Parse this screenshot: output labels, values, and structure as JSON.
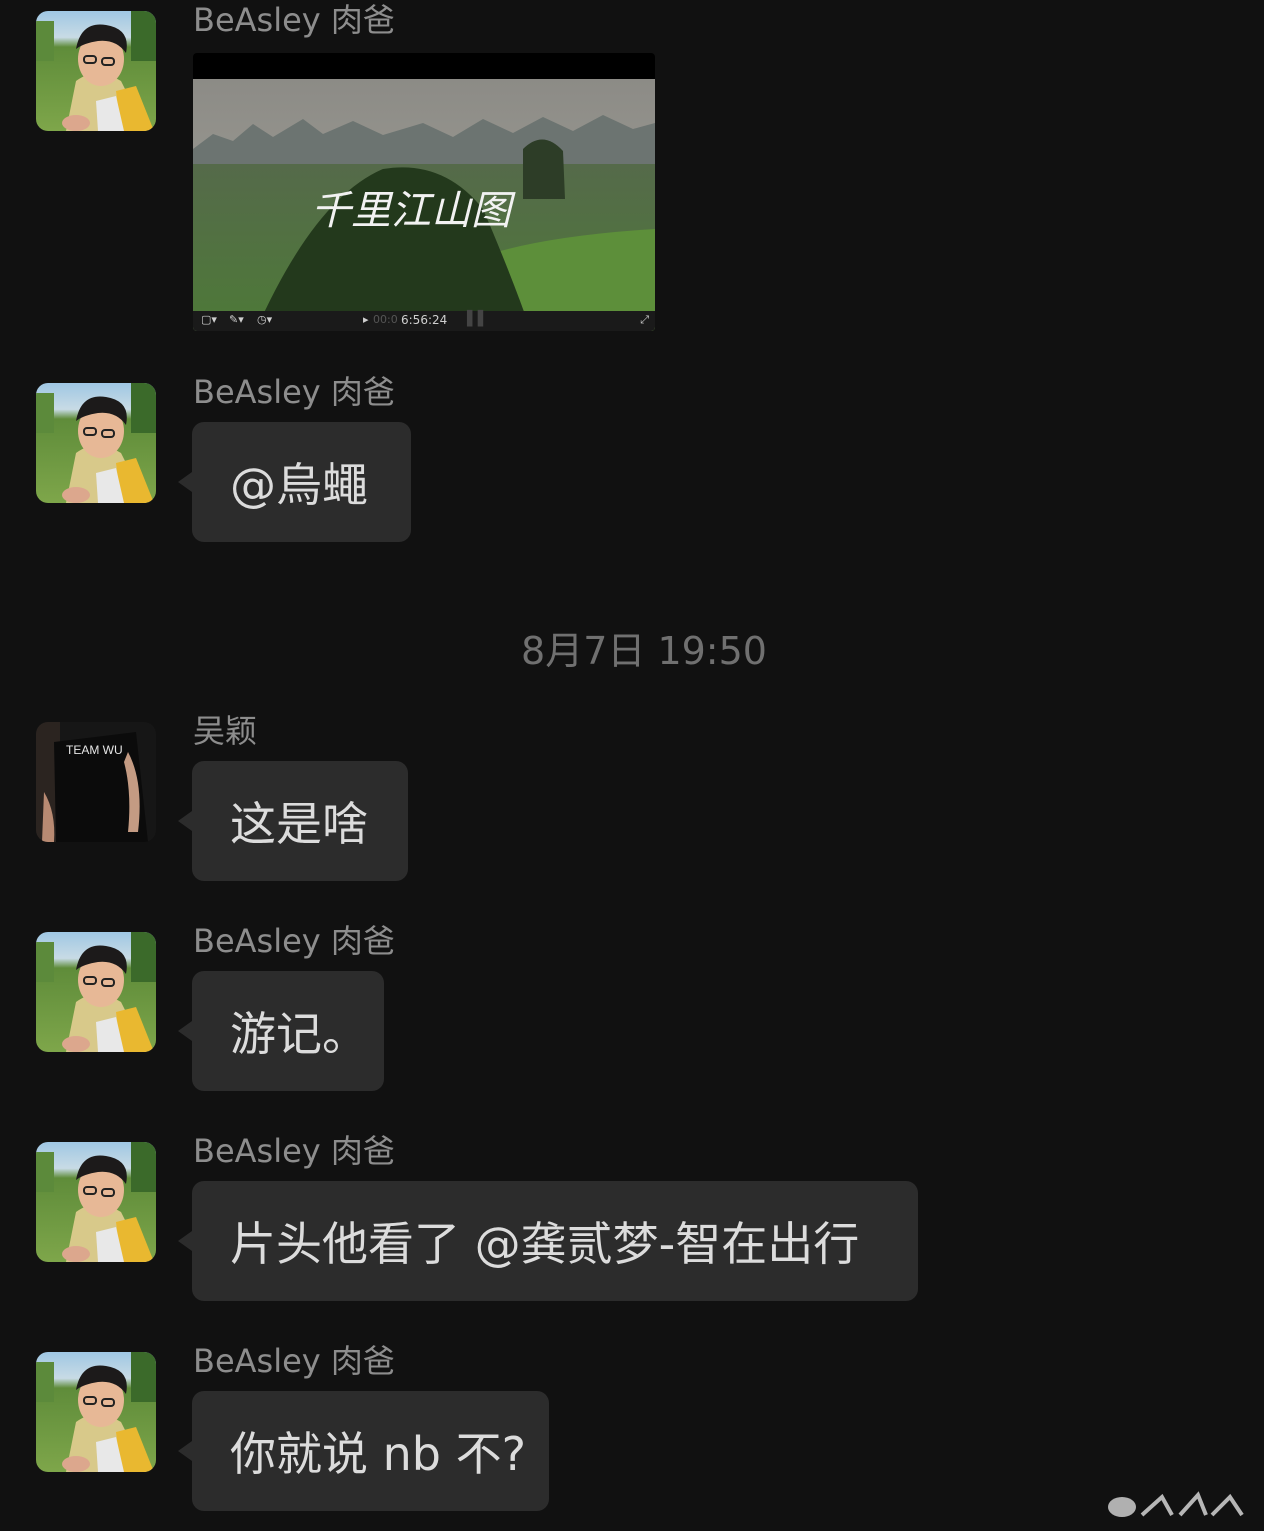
{
  "messages": [
    {
      "sender": "BeAsley 肉爸",
      "type": "video",
      "video": {
        "title_text": "千里江山图",
        "duration": "6:56:24",
        "elapsed": "00:0"
      }
    },
    {
      "sender": "BeAsley 肉爸",
      "type": "text",
      "text": "@烏蠅"
    },
    {
      "sender": "吴颖",
      "type": "text",
      "text": "这是啥",
      "avatar_shirt_text": "TEAM WU"
    },
    {
      "sender": "BeAsley 肉爸",
      "type": "text",
      "text": "游记。"
    },
    {
      "sender": "BeAsley 肉爸",
      "type": "text",
      "text": "片头他看了 @龚贰梦-智在出行"
    },
    {
      "sender": "BeAsley 肉爸",
      "type": "text",
      "text": "你就说 nb 不?"
    }
  ],
  "timestamp": "8月7日 19:50",
  "colors": {
    "background": "#111111",
    "bubble": "#2c2c2c",
    "name": "#8d8d8d",
    "text": "#dcdcdc"
  }
}
